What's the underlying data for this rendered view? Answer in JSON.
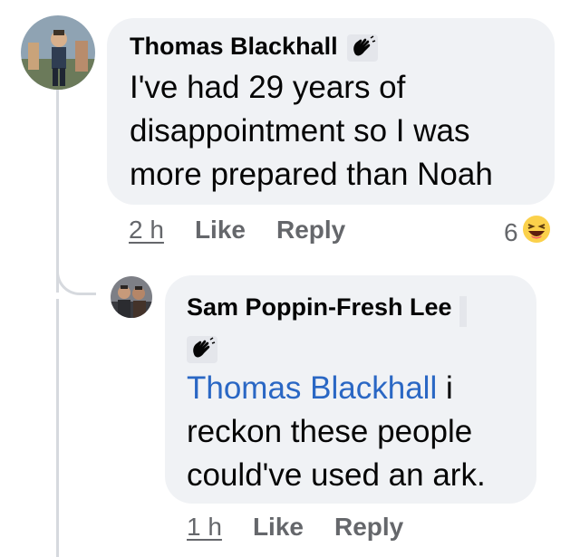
{
  "comments": [
    {
      "author": "Thomas Blackhall",
      "badge_icon": "waving-hand-icon",
      "text_lines": [
        "I've had 29 years of",
        "disappointment so I was",
        "more prepared than Noah"
      ],
      "time": "2 h",
      "like_label": "Like",
      "reply_label": "Reply",
      "reaction_count": "6",
      "reaction_icon": "laughing-emoji-icon"
    },
    {
      "author": "Sam Poppin-Fresh Lee",
      "badge_icon": "waving-hand-icon",
      "mention": "Thomas Blackhall",
      "text_first": " i",
      "text_lines": [
        "reckon these people",
        "could've used an ark."
      ],
      "time": "1 h",
      "like_label": "Like",
      "reply_label": "Reply"
    }
  ],
  "colors": {
    "bubble": "#f0f2f5",
    "mention": "#2a67c4",
    "meta": "#65676b",
    "text": "#050505"
  }
}
